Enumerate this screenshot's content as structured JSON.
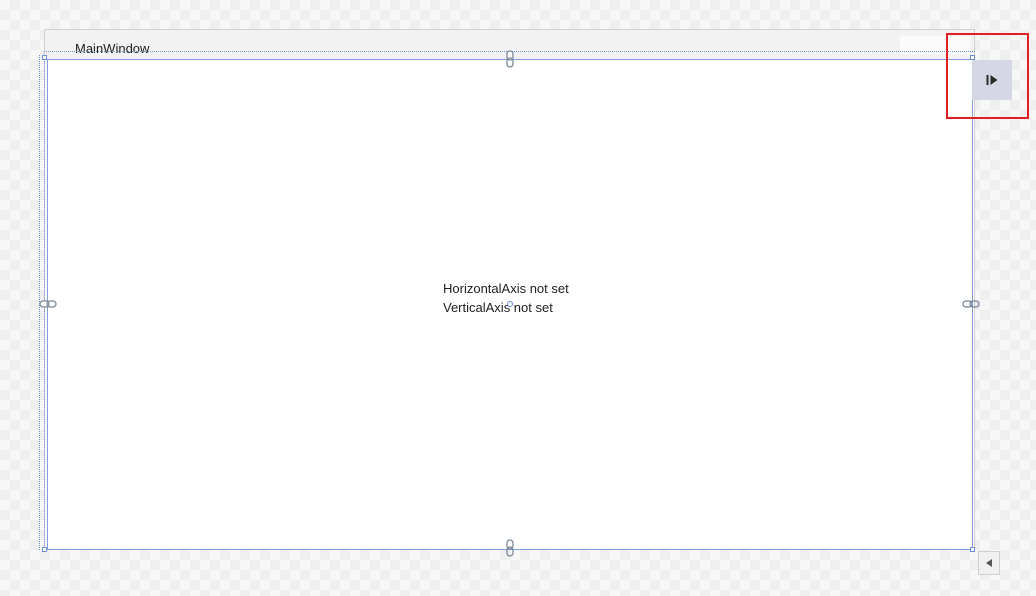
{
  "window": {
    "title": "MainWindow"
  },
  "designer": {
    "line1": "HorizontalAxis not set",
    "line2": "VerticalAxis not set"
  },
  "icons": {
    "adorner_button": "play-pause-icon",
    "scroll_button": "triangle-left-icon",
    "chain": "chain-link-icon"
  },
  "colors": {
    "selection_blue": "#7f9fe0",
    "highlight_red": "#e02020",
    "adorner_button_bg": "#d5d8e4"
  }
}
